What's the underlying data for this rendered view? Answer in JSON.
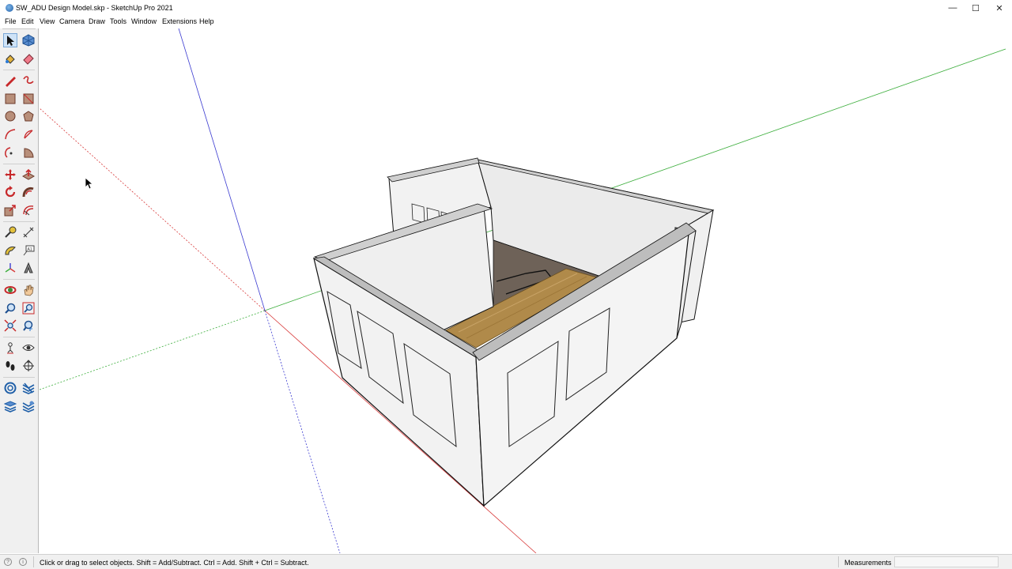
{
  "window": {
    "title": "SW_ADU Design Model.skp - SketchUp Pro 2021",
    "minimize_glyph": "—",
    "maximize_glyph": "☐",
    "close_glyph": "✕"
  },
  "menu": {
    "items": [
      {
        "label": "File"
      },
      {
        "label": "Edit"
      },
      {
        "label": "View"
      },
      {
        "label": "Camera"
      },
      {
        "label": "Draw"
      },
      {
        "label": "Tools"
      },
      {
        "label": "Window"
      },
      {
        "label": "Extensions"
      },
      {
        "label": "Help"
      }
    ]
  },
  "toolbar": {
    "tools": [
      {
        "name": "select-tool",
        "icon": "arrow-icon",
        "active": true
      },
      {
        "name": "make-component-tool",
        "icon": "component-icon"
      },
      {
        "name": "paint-bucket-tool",
        "icon": "paint-bucket-icon"
      },
      {
        "name": "eraser-tool",
        "icon": "eraser-icon"
      },
      {
        "name": "line-tool",
        "icon": "pencil-icon"
      },
      {
        "name": "freehand-tool",
        "icon": "freehand-icon"
      },
      {
        "name": "rectangle-tool",
        "icon": "rectangle-icon"
      },
      {
        "name": "rotated-rectangle-tool",
        "icon": "rotated-rectangle-icon"
      },
      {
        "name": "circle-tool",
        "icon": "circle-icon"
      },
      {
        "name": "polygon-tool",
        "icon": "polygon-icon"
      },
      {
        "name": "arc-tool",
        "icon": "arc-icon"
      },
      {
        "name": "two-point-arc-tool",
        "icon": "two-point-arc-icon"
      },
      {
        "name": "three-point-arc-tool",
        "icon": "three-point-arc-icon"
      },
      {
        "name": "pie-tool",
        "icon": "pie-icon"
      },
      {
        "name": "move-tool",
        "icon": "move-icon"
      },
      {
        "name": "push-pull-tool",
        "icon": "push-pull-icon"
      },
      {
        "name": "rotate-tool",
        "icon": "rotate-icon"
      },
      {
        "name": "follow-me-tool",
        "icon": "follow-me-icon"
      },
      {
        "name": "scale-tool",
        "icon": "scale-icon"
      },
      {
        "name": "offset-tool",
        "icon": "offset-icon"
      },
      {
        "name": "tape-measure-tool",
        "icon": "tape-measure-icon"
      },
      {
        "name": "dimension-tool",
        "icon": "dimension-icon"
      },
      {
        "name": "protractor-tool",
        "icon": "protractor-icon"
      },
      {
        "name": "text-tool",
        "icon": "text-icon"
      },
      {
        "name": "axes-tool",
        "icon": "axes-icon"
      },
      {
        "name": "3d-text-tool",
        "icon": "3d-text-icon"
      },
      {
        "name": "orbit-tool",
        "icon": "orbit-icon"
      },
      {
        "name": "pan-tool",
        "icon": "hand-icon"
      },
      {
        "name": "zoom-tool",
        "icon": "zoom-icon"
      },
      {
        "name": "zoom-window-tool",
        "icon": "zoom-window-icon"
      },
      {
        "name": "zoom-extents-tool",
        "icon": "zoom-extents-icon"
      },
      {
        "name": "previous-view-tool",
        "icon": "previous-view-icon"
      },
      {
        "name": "position-camera-tool",
        "icon": "position-camera-icon"
      },
      {
        "name": "look-around-tool",
        "icon": "eye-icon"
      },
      {
        "name": "walk-tool",
        "icon": "footprints-icon"
      },
      {
        "name": "section-plane-tool",
        "icon": "section-plane-icon"
      },
      {
        "name": "3d-warehouse-tool",
        "icon": "warehouse-icon"
      },
      {
        "name": "extension-warehouse-tool",
        "icon": "extension-warehouse-icon"
      },
      {
        "name": "share-model-tool",
        "icon": "share-model-icon"
      },
      {
        "name": "extension-manager-tool",
        "icon": "extension-manager-icon"
      }
    ]
  },
  "status": {
    "hint": "Click or drag to select objects. Shift = Add/Subtract. Ctrl = Add. Shift + Ctrl = Subtract.",
    "measurements_label": "Measurements",
    "measurements_value": ""
  },
  "colors": {
    "red_axis": "#d83a3a",
    "green_axis": "#3cae3c",
    "blue_axis": "#3a3ad0",
    "wall_fill": "#f1f1f1",
    "wall_inner": "#e6e6e6",
    "floor_wood": "#b08a4a",
    "floor_dark": "#6e6258"
  }
}
